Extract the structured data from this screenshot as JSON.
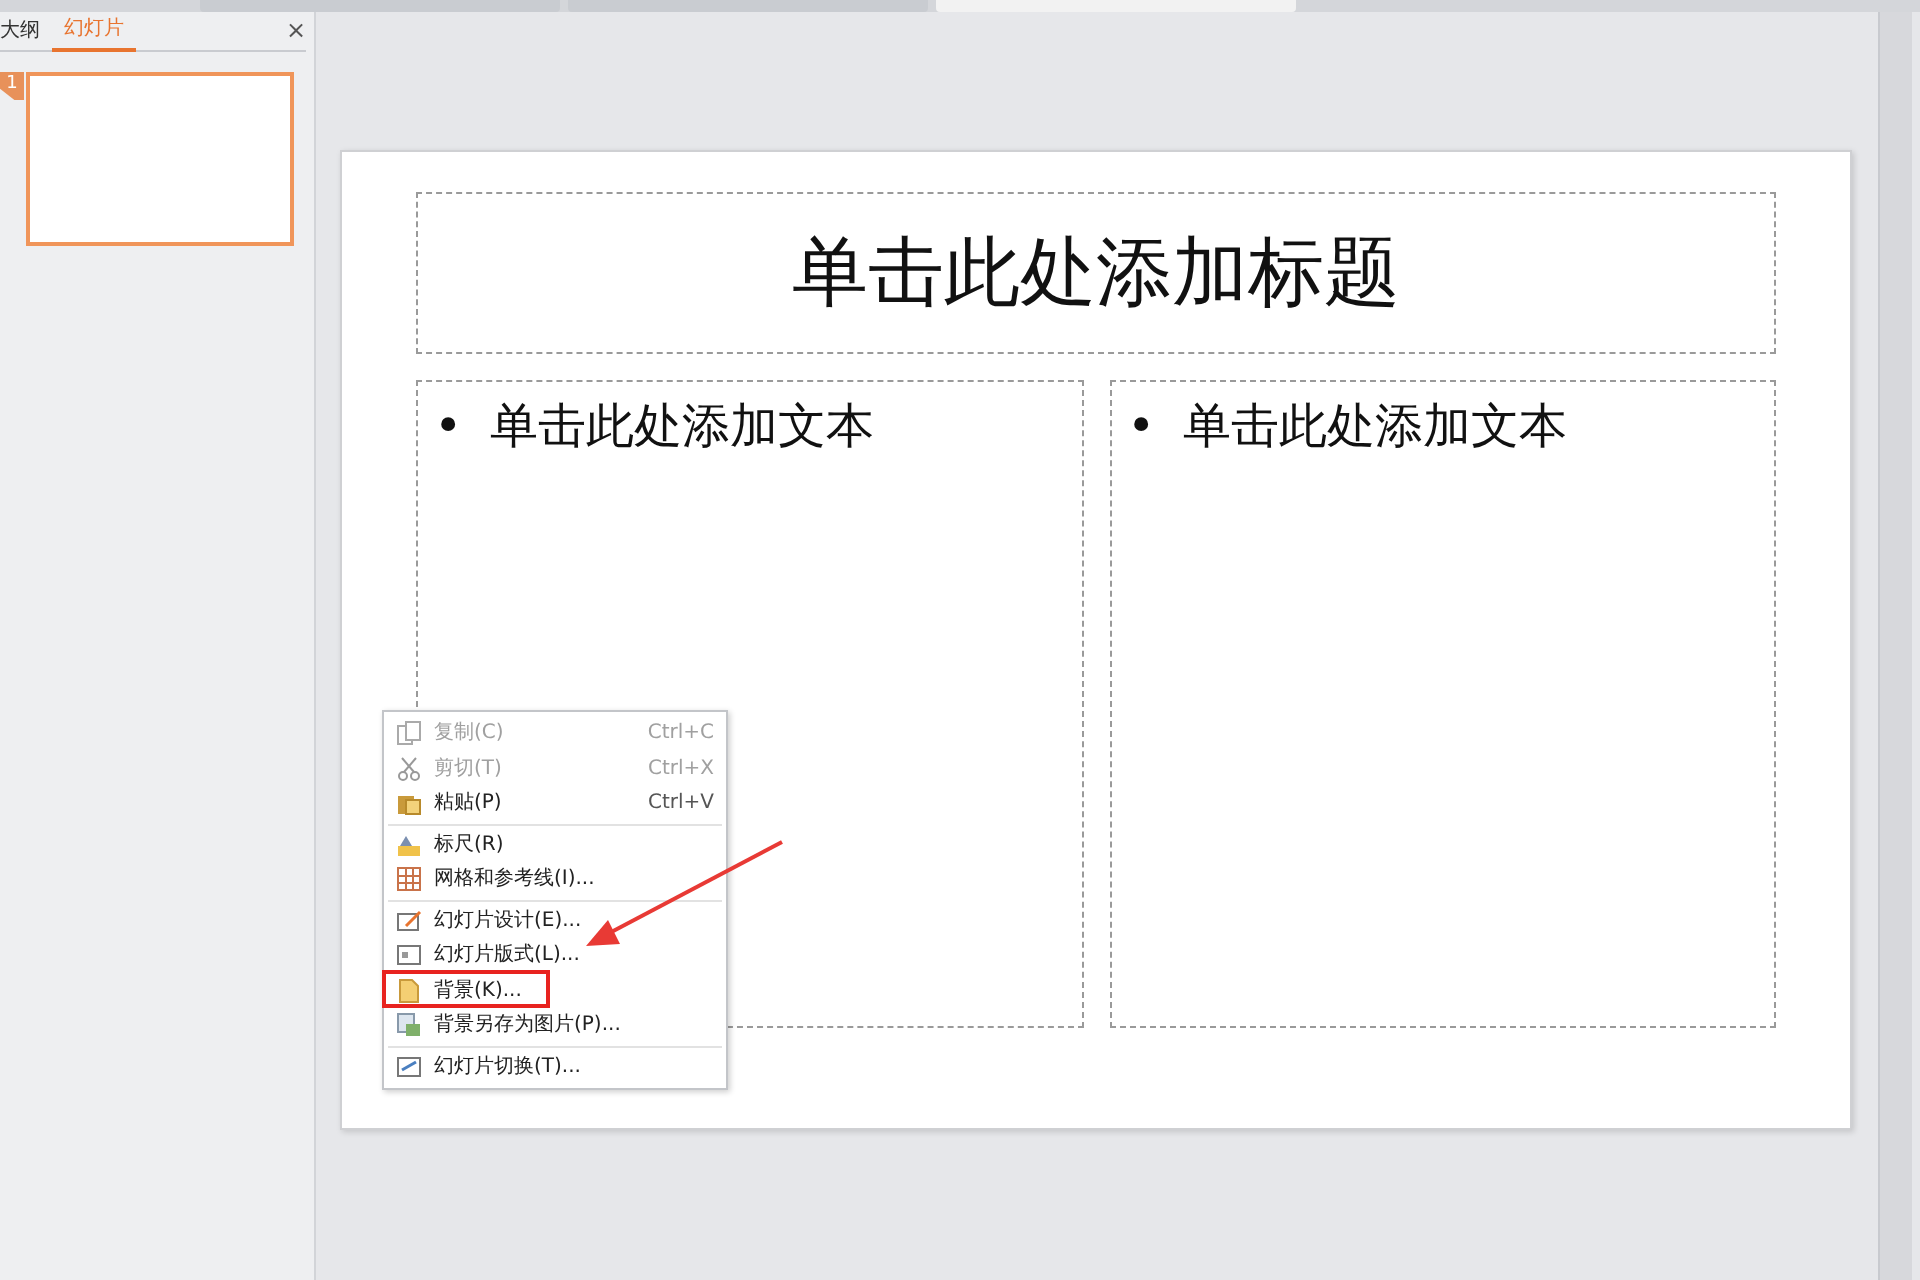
{
  "panel_tabs": [
    {
      "label": "大纲",
      "selected": false
    },
    {
      "label": "幻灯片",
      "selected": true
    }
  ],
  "panel_close": "×",
  "thumbnails": [
    {
      "number": "1",
      "selected": true
    }
  ],
  "slide": {
    "title": "单击此处添加标题",
    "columns": [
      {
        "bullet": "•",
        "text": "单击此处添加文本"
      },
      {
        "bullet": "•",
        "text": "单击此处添加文本"
      }
    ]
  },
  "context_menu": [
    {
      "kind": "item",
      "label": "复制(C)",
      "shortcut": "Ctrl+C",
      "disabled": true,
      "highlighted": false
    },
    {
      "kind": "item",
      "label": "剪切(T)",
      "shortcut": "Ctrl+X",
      "disabled": true,
      "highlighted": false
    },
    {
      "kind": "item",
      "label": "粘贴(P)",
      "shortcut": "Ctrl+V",
      "disabled": false,
      "highlighted": false
    },
    {
      "kind": "separator"
    },
    {
      "kind": "item",
      "label": "标尺(R)",
      "disabled": false,
      "highlighted": false
    },
    {
      "kind": "item",
      "label": "网格和参考线(I)...",
      "disabled": false,
      "highlighted": false
    },
    {
      "kind": "separator"
    },
    {
      "kind": "item",
      "label": "幻灯片设计(E)...",
      "disabled": false,
      "highlighted": false
    },
    {
      "kind": "item",
      "label": "幻灯片版式(L)...",
      "disabled": false,
      "highlighted": false
    },
    {
      "kind": "item",
      "label": "背景(K)...",
      "disabled": false,
      "highlighted": true
    },
    {
      "kind": "item",
      "label": "背景另存为图片(P)...",
      "disabled": false,
      "highlighted": false
    },
    {
      "kind": "separator"
    },
    {
      "kind": "item",
      "label": "幻灯片切换(T)...",
      "disabled": false,
      "highlighted": false
    }
  ]
}
